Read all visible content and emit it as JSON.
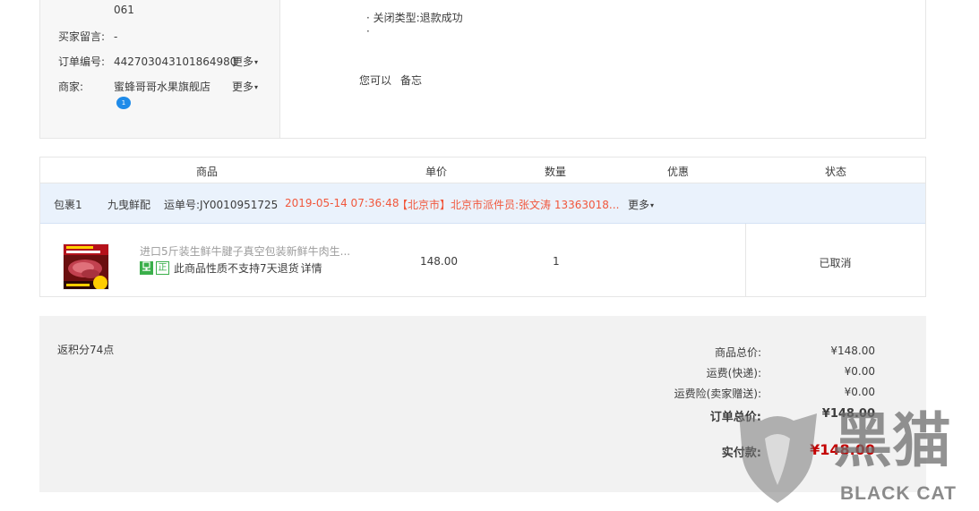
{
  "order_info": {
    "address_tail": "061",
    "buyer_note_label": "买家留言:",
    "buyer_note_value": "-",
    "order_no_label": "订单编号:",
    "order_no_value": "442703043101864980",
    "merchant_label": "商家:",
    "merchant_value": "蜜蜂哥哥水果旗舰店",
    "more_label": "更多",
    "ww_badge": "1"
  },
  "status_info": {
    "close_type": "· 关闭类型:退款成功",
    "bullet": "·",
    "you_can": "您可以",
    "memo_link": "备忘"
  },
  "goods_table": {
    "headers": [
      "商品",
      "单价",
      "数量",
      "优惠",
      "状态"
    ],
    "package": {
      "name": "包裹1",
      "carrier": "九曳鲜配",
      "tracking": "运单号:JY0010951725",
      "time": "2019-05-14 07:36:48",
      "location": "【北京市】北京市派件员:张文涛 13363018...",
      "more": "更多"
    },
    "item": {
      "title": "进口5斤装生鲜牛腱子真空包装新鲜牛肉生...",
      "tag1": "",
      "tag2": "正",
      "note": "此商品性质不支持7天退货",
      "detail": "详情",
      "price": "148.00",
      "qty": "1",
      "discount": "",
      "status": "已取消"
    }
  },
  "summary": {
    "points": "返积分74点",
    "goods_total_label": "商品总价:",
    "goods_total_value": "¥148.00",
    "shipping_label": "运费(快递):",
    "shipping_value": "¥0.00",
    "insurance_label": "运费险(卖家赠送):",
    "insurance_value": "¥0.00",
    "order_total_label": "订单总价:",
    "order_total_value": "¥148.00",
    "paid_label": "实付款:",
    "paid_value": "¥148.00"
  },
  "watermark": {
    "cn": "黑猫",
    "en": "BLACK CAT"
  },
  "colors": {
    "accent_red": "#c40000",
    "logistics_orange": "#f1573c",
    "package_bg": "#eaf2fc",
    "tag_green": "#3aaf4a"
  }
}
